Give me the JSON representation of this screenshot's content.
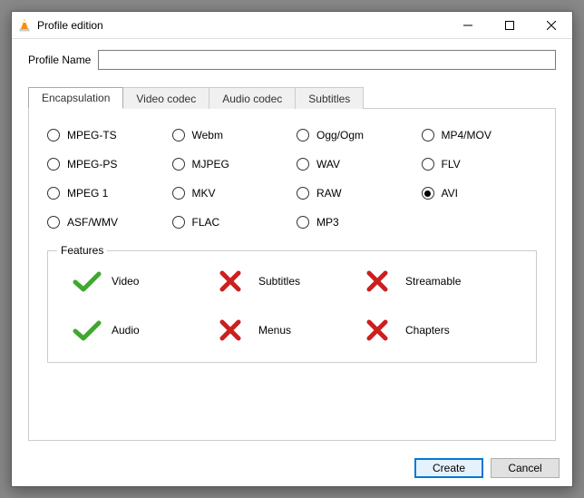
{
  "title": "Profile edition",
  "profileNameLabel": "Profile Name",
  "profileNameValue": "",
  "tabs": [
    {
      "label": "Encapsulation",
      "active": true
    },
    {
      "label": "Video codec",
      "active": false
    },
    {
      "label": "Audio codec",
      "active": false
    },
    {
      "label": "Subtitles",
      "active": false
    }
  ],
  "radios": [
    {
      "label": "MPEG-TS",
      "selected": false
    },
    {
      "label": "Webm",
      "selected": false
    },
    {
      "label": "Ogg/Ogm",
      "selected": false
    },
    {
      "label": "MP4/MOV",
      "selected": false
    },
    {
      "label": "MPEG-PS",
      "selected": false
    },
    {
      "label": "MJPEG",
      "selected": false
    },
    {
      "label": "WAV",
      "selected": false
    },
    {
      "label": "FLV",
      "selected": false
    },
    {
      "label": "MPEG 1",
      "selected": false
    },
    {
      "label": "MKV",
      "selected": false
    },
    {
      "label": "RAW",
      "selected": false
    },
    {
      "label": "AVI",
      "selected": true
    },
    {
      "label": "ASF/WMV",
      "selected": false
    },
    {
      "label": "FLAC",
      "selected": false
    },
    {
      "label": "MP3",
      "selected": false
    }
  ],
  "featuresLegend": "Features",
  "features": [
    {
      "label": "Video",
      "ok": true
    },
    {
      "label": "Subtitles",
      "ok": false
    },
    {
      "label": "Streamable",
      "ok": false
    },
    {
      "label": "Audio",
      "ok": true
    },
    {
      "label": "Menus",
      "ok": false
    },
    {
      "label": "Chapters",
      "ok": false
    }
  ],
  "buttons": {
    "create": "Create",
    "cancel": "Cancel"
  }
}
